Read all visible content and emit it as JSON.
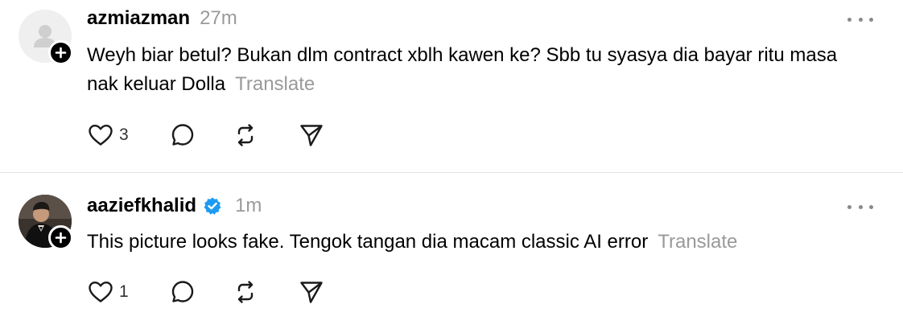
{
  "posts": [
    {
      "username": "azmiazman",
      "time": "27m",
      "verified": false,
      "avatar": "blank-user-icon",
      "text": "Weyh biar betul? Bukan dlm contract xblh kawen ke? Sbb tu syasya dia bayar ritu masa nak keluar Dolla",
      "translate_label": "Translate",
      "likes": "3"
    },
    {
      "username": "aaziefkhalid",
      "time": "1m",
      "verified": true,
      "avatar": "profile-photo",
      "text": "This picture looks fake. Tengok tangan dia macam classic AI error",
      "translate_label": "Translate",
      "likes": "1"
    }
  ],
  "colors": {
    "muted_text": "#9a9a9a",
    "verified_badge": "#1d9bf0",
    "divider": "#e2e2e2"
  },
  "icons": {
    "like": "heart-icon",
    "reply": "comment-icon",
    "repost": "repost-icon",
    "share": "send-icon",
    "more": "more-options-icon",
    "follow": "plus-icon"
  }
}
